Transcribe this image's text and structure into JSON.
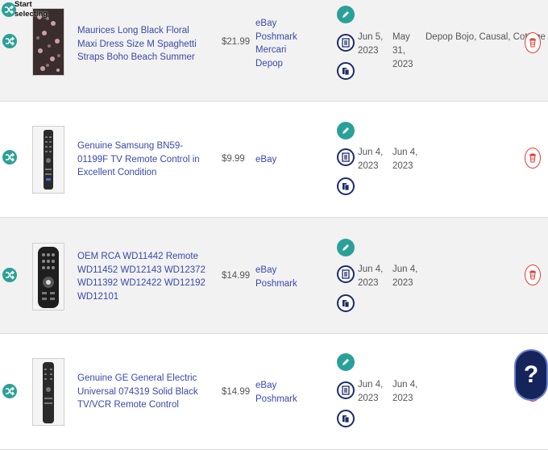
{
  "toolbar": {
    "start_selecting_label": "Start selecting"
  },
  "help": {
    "label": "?"
  },
  "listings": [
    {
      "title": "Maurices Long Black Floral Maxi Dress Size M Spaghetti Straps Boho Beach Summer",
      "price": "$21.99",
      "marketplaces": [
        "eBay",
        "Poshmark",
        "Mercari",
        "Depop"
      ],
      "date_created": [
        "Jun 5,",
        "2023"
      ],
      "date_listed": [
        "May 31,",
        "2023"
      ],
      "tags": "Depop Bojo, Causal, Cottage",
      "image": "floral-dress-icon"
    },
    {
      "title": "Genuine Samsung BN59-01199F TV Remote Control in Excellent Condition",
      "price": "$9.99",
      "marketplaces": [
        "eBay"
      ],
      "date_created": [
        "Jun 4,",
        "2023"
      ],
      "date_listed": [
        "Jun 4,",
        "2023"
      ],
      "tags": "",
      "image": "remote-control-icon"
    },
    {
      "title": "OEM RCA WD11442 Remote WD11452 WD12143 WD12372 WD11392 WD12422 WD12192 WD12101",
      "price": "$14.99",
      "marketplaces": [
        "eBay",
        "Poshmark"
      ],
      "date_created": [
        "Jun 4,",
        "2023"
      ],
      "date_listed": [
        "Jun 4,",
        "2023"
      ],
      "tags": "",
      "image": "remote-control-icon"
    },
    {
      "title": "Genuine GE General Electric Universal 074319 Solid Black TV/VCR Remote Control",
      "price": "$14.99",
      "marketplaces": [
        "eBay",
        "Poshmark"
      ],
      "date_created": [
        "Jun 4,",
        "2023"
      ],
      "date_listed": [
        "Jun 4,",
        "2023"
      ],
      "tags": "",
      "image": "remote-control-icon"
    }
  ],
  "colors": {
    "accent_teal": "#2aa198",
    "link_blue": "#3949ab",
    "navy": "#1c2b6b",
    "delete_red": "#e53935"
  }
}
